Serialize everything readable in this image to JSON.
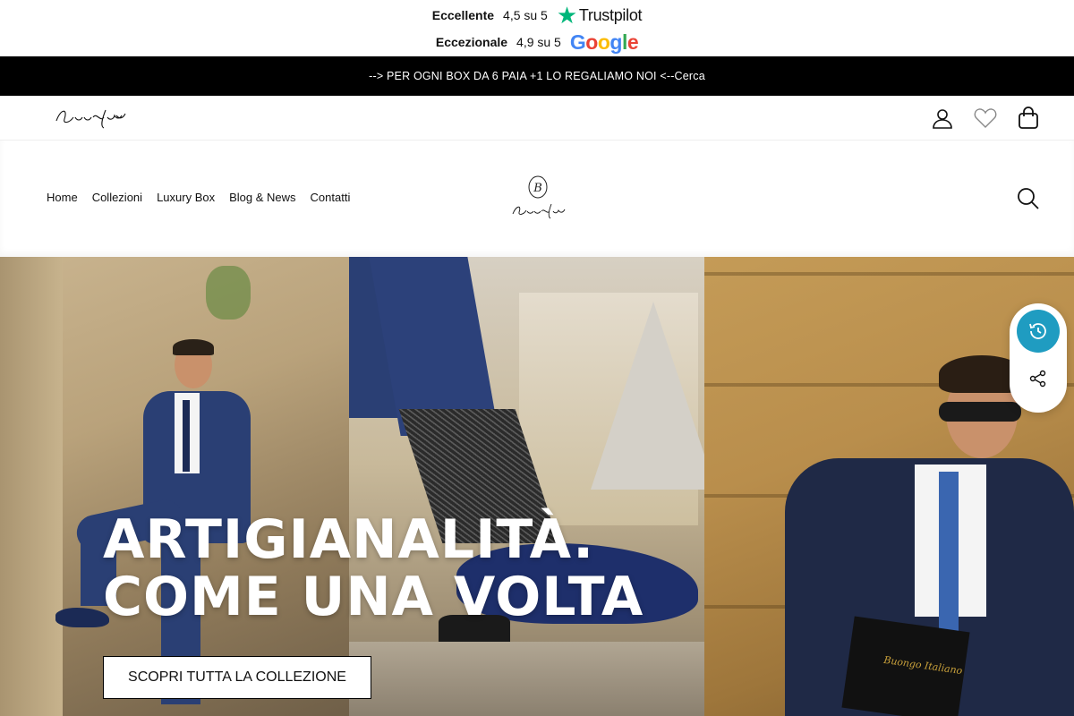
{
  "ratings": {
    "trustpilot": {
      "label": "Eccellente",
      "score": "4,5 su 5",
      "brand": "Trustpilot"
    },
    "google": {
      "label": "Eccezionale",
      "score": "4,9 su 5",
      "brand_letters": [
        "G",
        "o",
        "o",
        "g",
        "l",
        "e"
      ]
    }
  },
  "announcement": "--> PER OGNI BOX DA 6 PAIA +1 LO REGALIAMO NOI  <--Cerca",
  "brand": {
    "small_logo": "Buongo Italiano",
    "center_monogram": "B",
    "center_word": "Buongo Italiano"
  },
  "nav": {
    "items": [
      {
        "label": "Home"
      },
      {
        "label": "Collezioni"
      },
      {
        "label": "Luxury Box"
      },
      {
        "label": "Blog & News"
      },
      {
        "label": "Contatti"
      }
    ]
  },
  "utility_icons": [
    "user-icon",
    "heart-icon",
    "bag-icon"
  ],
  "hero": {
    "title_line1": "ARTIGIANALITÀ.",
    "title_line2": "COME UNA VOLTA",
    "cta_label": "SCOPRI TUTTA LA COLLEZIONE"
  },
  "side_widget": {
    "icons": [
      "history-icon",
      "share-icon"
    ],
    "accent": "#1f9cc1"
  },
  "colors": {
    "announcement_bg": "#000000",
    "trustpilot_green": "#00b67a"
  }
}
